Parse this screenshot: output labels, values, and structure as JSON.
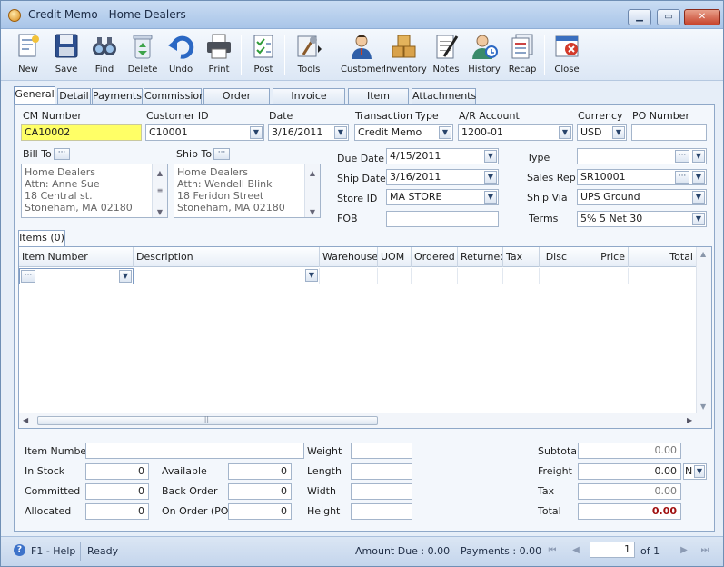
{
  "window": {
    "title": "Credit Memo - Home Dealers",
    "min": "▁",
    "max": "▭",
    "close": "✕"
  },
  "toolbar": [
    {
      "key": "new",
      "label": "New",
      "icon": "new-document-icon"
    },
    {
      "key": "save",
      "label": "Save",
      "icon": "floppy-disk-icon"
    },
    {
      "key": "find",
      "label": "Find",
      "icon": "binoculars-icon"
    },
    {
      "key": "delete",
      "label": "Delete",
      "icon": "recycle-bin-icon"
    },
    {
      "key": "undo",
      "label": "Undo",
      "icon": "undo-arrow-icon"
    },
    {
      "key": "print",
      "label": "Print",
      "icon": "printer-icon"
    },
    {
      "key": "post",
      "label": "Post",
      "icon": "post-checklist-icon"
    },
    {
      "key": "tools",
      "label": "Tools",
      "icon": "tools-icon"
    },
    {
      "key": "customer",
      "label": "Customer",
      "icon": "customer-person-icon"
    },
    {
      "key": "inventory",
      "label": "Inventory",
      "icon": "boxes-icon"
    },
    {
      "key": "notes",
      "label": "Notes",
      "icon": "notepad-pen-icon"
    },
    {
      "key": "history",
      "label": "History",
      "icon": "history-person-icon"
    },
    {
      "key": "recap",
      "label": "Recap",
      "icon": "recap-sheets-icon"
    },
    {
      "key": "close",
      "label": "Close",
      "icon": "close-window-icon"
    }
  ],
  "tabs": [
    "General",
    "Detail",
    "Payments",
    "Commission",
    "Order History",
    "Invoice History",
    "Item History",
    "Attachments"
  ],
  "form": {
    "cm_number_label": "CM Number",
    "cm_number": "CA10002",
    "customer_id_label": "Customer ID",
    "customer_id": "C10001",
    "date_label": "Date",
    "date": "3/16/2011",
    "transaction_type_label": "Transaction Type",
    "transaction_type": "Credit Memo",
    "ar_account_label": "A/R Account",
    "ar_account": "1200-01",
    "currency_label": "Currency",
    "currency": "USD",
    "po_number_label": "PO Number",
    "po_number": "",
    "bill_to_label": "Bill To",
    "ship_to_label": "Ship To",
    "bill_to": [
      "Home Dealers",
      "Attn: Anne Sue",
      "18 Central st.",
      "Stoneham, MA 02180"
    ],
    "ship_to": [
      "Home Dealers",
      "Attn: Wendell Blink",
      "18 Feridon Street",
      "Stoneham, MA 02180"
    ],
    "due_date_label": "Due Date",
    "due_date": "4/15/2011",
    "ship_date_label": "Ship Date",
    "ship_date": "3/16/2011",
    "store_id_label": "Store ID",
    "store_id": "MA STORE",
    "fob_label": "FOB",
    "fob": "",
    "type_label": "Type",
    "type": "",
    "sales_rep_label": "Sales Rep",
    "sales_rep": "SR10001",
    "ship_via_label": "Ship Via",
    "ship_via": "UPS Ground",
    "terms_label": "Terms",
    "terms": "5% 5 Net 30"
  },
  "items_tab": "Items (0)",
  "grid": {
    "columns": [
      "Item Number",
      "Description",
      "Warehouse",
      "UOM",
      "Ordered",
      "Returned",
      "Tax",
      "Disc",
      "Price",
      "Total"
    ],
    "ellipsis": "···"
  },
  "bottom": {
    "item_number_label": "Item Number",
    "item_number": "",
    "in_stock_label": "In Stock",
    "in_stock": "0",
    "committed_label": "Committed",
    "committed": "0",
    "allocated_label": "Allocated",
    "allocated": "0",
    "available_label": "Available",
    "available": "0",
    "back_order_label": "Back Order",
    "back_order": "0",
    "on_order_label": "On Order (PO)",
    "on_order": "0",
    "weight_label": "Weight",
    "weight": "",
    "length_label": "Length",
    "length": "",
    "width_label": "Width",
    "width": "",
    "height_label": "Height",
    "height": "",
    "subtotal_label": "Subtotal",
    "subtotal": "0.00",
    "freight_label": "Freight",
    "freight": "0.00",
    "freight_code": "N",
    "tax_label": "Tax",
    "tax": "0.00",
    "total_label": "Total",
    "total": "0.00"
  },
  "status": {
    "help": "F1 - Help",
    "ready": "Ready",
    "amount_due": "Amount Due : 0.00",
    "payments": "Payments : 0.00",
    "page": "1",
    "of": "of  1"
  }
}
